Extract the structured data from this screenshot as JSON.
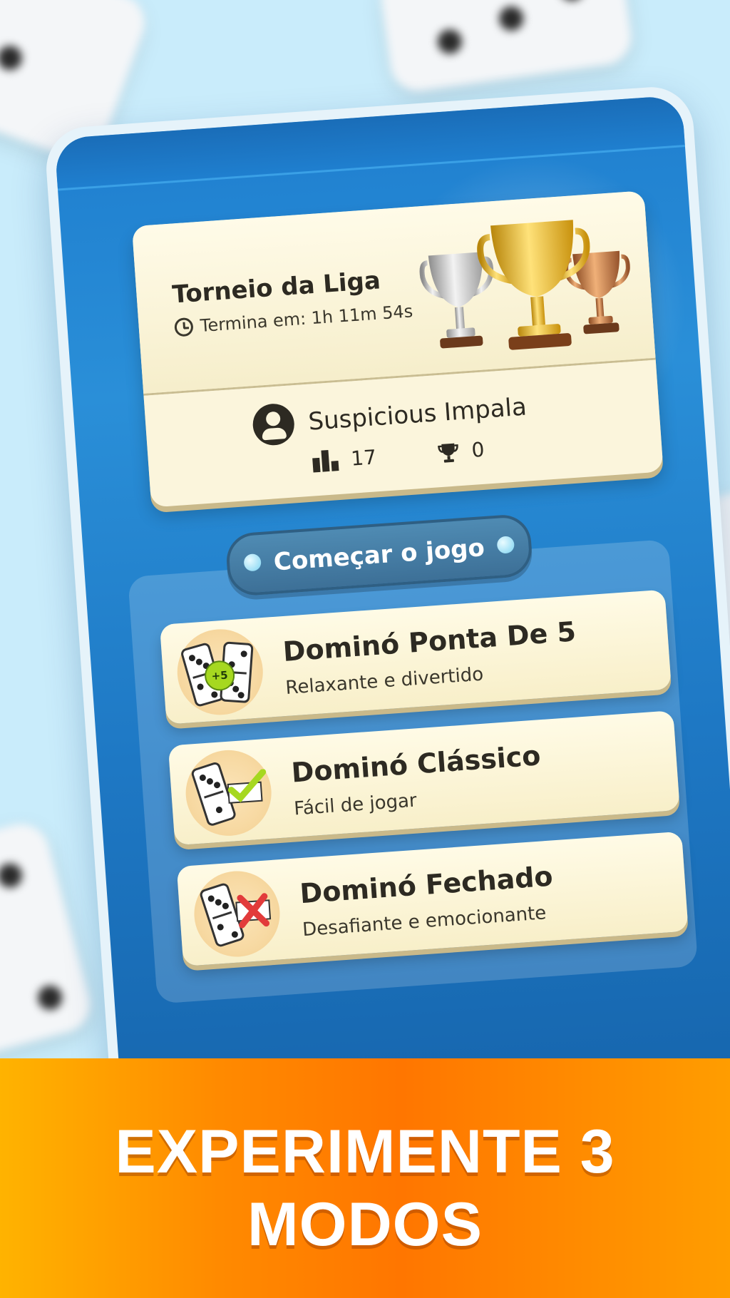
{
  "league": {
    "title": "Torneio da Liga",
    "timer_label": "Termina em: 1h 11m 54s",
    "player_name": "Suspicious Impala",
    "rank_value": "17",
    "trophy_value": "0"
  },
  "section": {
    "title": "Começar o jogo"
  },
  "modes": [
    {
      "title": "Dominó Ponta De 5",
      "subtitle": "Relaxante e divertido",
      "badge": "+5"
    },
    {
      "title": "Dominó Clássico",
      "subtitle": "Fácil de jogar"
    },
    {
      "title": "Dominó Fechado",
      "subtitle": "Desafiante e emocionante"
    }
  ],
  "banner": {
    "line1": "EXPERIMENTE 3",
    "line2": "MODOS"
  },
  "colors": {
    "screen_blue": "#1f7fcf",
    "card_cream": "#fbf5dc",
    "banner_orange": "#ff8a00",
    "check_green": "#a6d820",
    "cross_red": "#e23b3b"
  }
}
